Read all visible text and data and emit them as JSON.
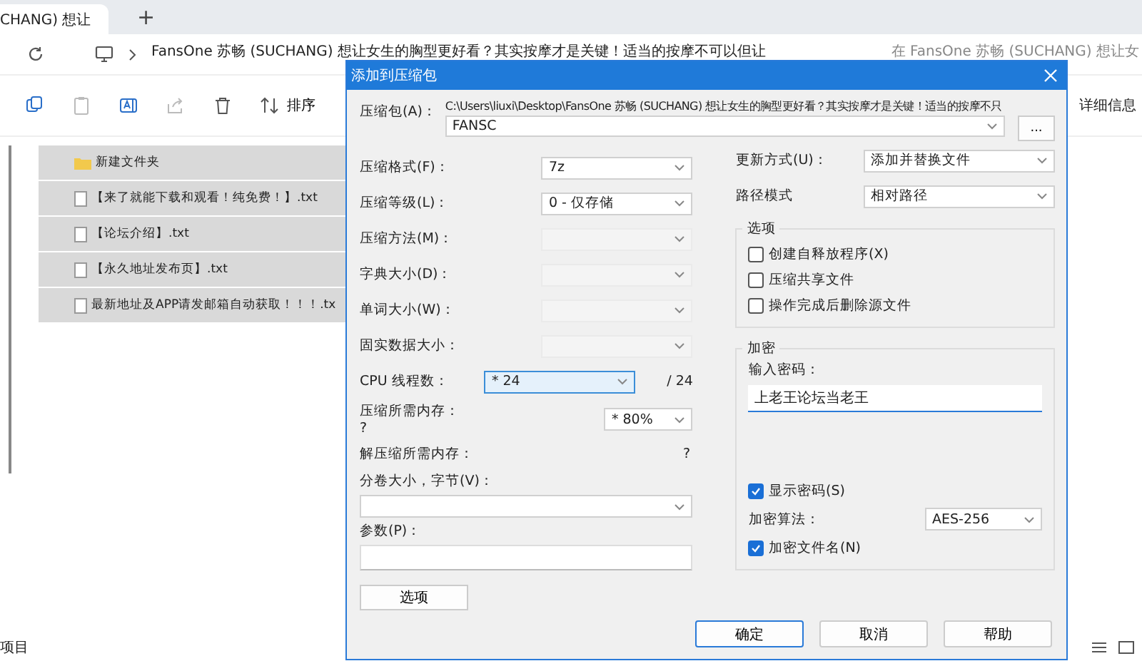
{
  "browser_tab": {
    "title": "CHANG) 想让"
  },
  "new_tab": "+",
  "address_bar": {
    "path": "FansOne 苏畅 (SUCHANG) 想让女生的胸型更好看？其实按摩才是关键！适当的按摩不可以但让",
    "search_placeholder": "在 FansOne 苏畅 (SUCHANG) 想让女"
  },
  "toolbar": {
    "sort": "排序",
    "details": "详细信息"
  },
  "files": [
    {
      "kind": "folder",
      "name": "新建文件夹",
      "selected": true
    },
    {
      "kind": "file",
      "name": "【来了就能下载和观看！纯免费！】.txt",
      "selected": true
    },
    {
      "kind": "file",
      "name": "【论坛介绍】.txt",
      "selected": true
    },
    {
      "kind": "file",
      "name": "【永久地址发布页】.txt",
      "selected": true
    },
    {
      "kind": "file",
      "name": "最新地址及APP请发邮箱自动获取！！！.tx",
      "selected": true
    }
  ],
  "status_bar": "项目",
  "dialog": {
    "title": "添加到压缩包",
    "archive": {
      "label": "压缩包(A)：",
      "path": "C:\\Users\\liuxi\\Desktop\\FansOne 苏畅 (SUCHANG) 想让女生的胸型更好看？其实按摩才是关键！适当的按摩不只",
      "value": "FANSC",
      "browse": "..."
    },
    "left_fields": [
      {
        "kind": "select",
        "label": "压缩格式(F)：",
        "value": "7z",
        "disabled": false
      },
      {
        "kind": "select",
        "label": "压缩等级(L)：",
        "value": "0 - 仅存储",
        "disabled": false
      },
      {
        "kind": "select",
        "label": "压缩方法(M)：",
        "disabled": true
      },
      {
        "kind": "select",
        "label": "字典大小(D)：",
        "disabled": true
      },
      {
        "kind": "select",
        "label": "单词大小(W)：",
        "disabled": true
      },
      {
        "kind": "select",
        "label": "固实数据大小：",
        "disabled": true
      },
      {
        "kind": "threads",
        "label": "CPU 线程数：",
        "value": "* 24",
        "total": "/ 24"
      },
      {
        "kind": "memory",
        "label": "压缩所需内存：",
        "note": "?",
        "value": "* 80%",
        "disabled": false
      },
      {
        "kind": "info",
        "label": "解压缩所需内存：",
        "note": "?"
      },
      {
        "kind": "wide_select",
        "label": "分卷大小，字节(V)：",
        "disabled": false
      },
      {
        "kind": "text",
        "label": "参数(P)："
      }
    ],
    "options_button": "选项",
    "update_mode": {
      "label": "更新方式(U)：",
      "value": "添加并替换文件"
    },
    "path_mode": {
      "label": "路径模式",
      "value": "相对路径"
    },
    "options": {
      "title": "选项",
      "items": [
        {
          "label": "创建自释放程序(X)",
          "checked": false
        },
        {
          "label": "压缩共享文件",
          "checked": false
        },
        {
          "label": "操作完成后删除源文件",
          "checked": false
        }
      ]
    },
    "encryption": {
      "title": "加密",
      "password_label": "输入密码：",
      "password": "上老王论坛当老王",
      "show_password": {
        "label": "显示密码(S)",
        "checked": true
      },
      "method_label": "加密算法：",
      "method": "AES-256",
      "encrypt_names": {
        "label": "加密文件名(N)",
        "checked": true
      }
    },
    "buttons": [
      {
        "label": "确定",
        "default": true
      },
      {
        "label": "取消",
        "default": false
      },
      {
        "label": "帮助",
        "default": false
      }
    ]
  }
}
